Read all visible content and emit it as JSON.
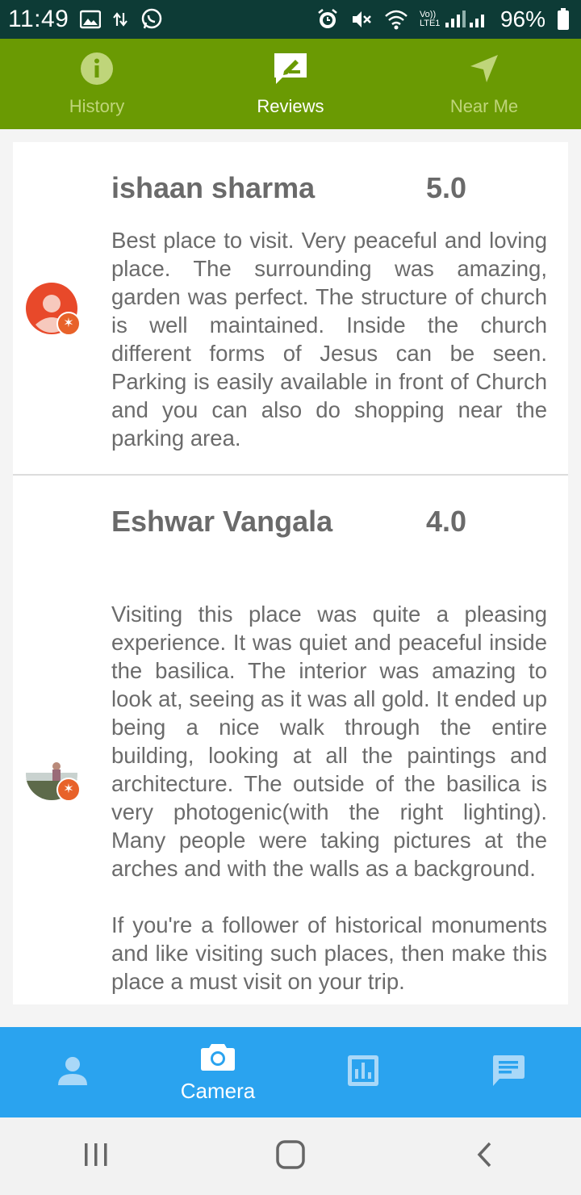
{
  "status_bar": {
    "time": "11:49",
    "battery": "96%",
    "network_label": "Vo)) LTE1",
    "icons": [
      "image-icon",
      "data-transfer-icon",
      "whatsapp-icon",
      "alarm-icon",
      "mute-icon",
      "wifi-icon",
      "signal-icon",
      "battery-icon"
    ]
  },
  "top_tabs": [
    {
      "label": "History",
      "icon": "info-icon",
      "active": false
    },
    {
      "label": "Reviews",
      "icon": "review-icon",
      "active": true
    },
    {
      "label": "Near Me",
      "icon": "navigation-icon",
      "active": false
    }
  ],
  "reviews": [
    {
      "name": "ishaan sharma",
      "rating": "5.0",
      "text": "Best place to visit. Very peaceful and loving place. The surrounding was amazing, garden was perfect. The structure of church is well maintained. Inside the church different forms of Jesus can be seen. Parking is easily available in front of Church  and you can also do shopping near the parking area."
    },
    {
      "name": "Eshwar Vangala",
      "rating": "4.0",
      "text": "Visiting this place was quite a pleasing experience. It was quiet and peaceful inside the basilica. The interior was amazing to look at, seeing as it was all gold. It ended up being a nice walk through the entire building, looking at  all the paintings and architecture. The outside of the basilica is very photogenic(with the right lighting). Many people were taking pictures at the arches and with the walls as a background.\n\nIf you're a follower of historical monuments and like visiting such places, then make this place a must visit on your trip."
    }
  ],
  "bottom_nav": [
    {
      "label": "",
      "icon": "person-icon"
    },
    {
      "label": "Camera",
      "icon": "camera-icon"
    },
    {
      "label": "",
      "icon": "chart-icon"
    },
    {
      "label": "",
      "icon": "chat-icon"
    }
  ],
  "colors": {
    "status_bar": "#0d3b36",
    "top_bar": "#6a9a03",
    "bottom_bar": "#2aa3ef",
    "badge": "#e8622a"
  }
}
